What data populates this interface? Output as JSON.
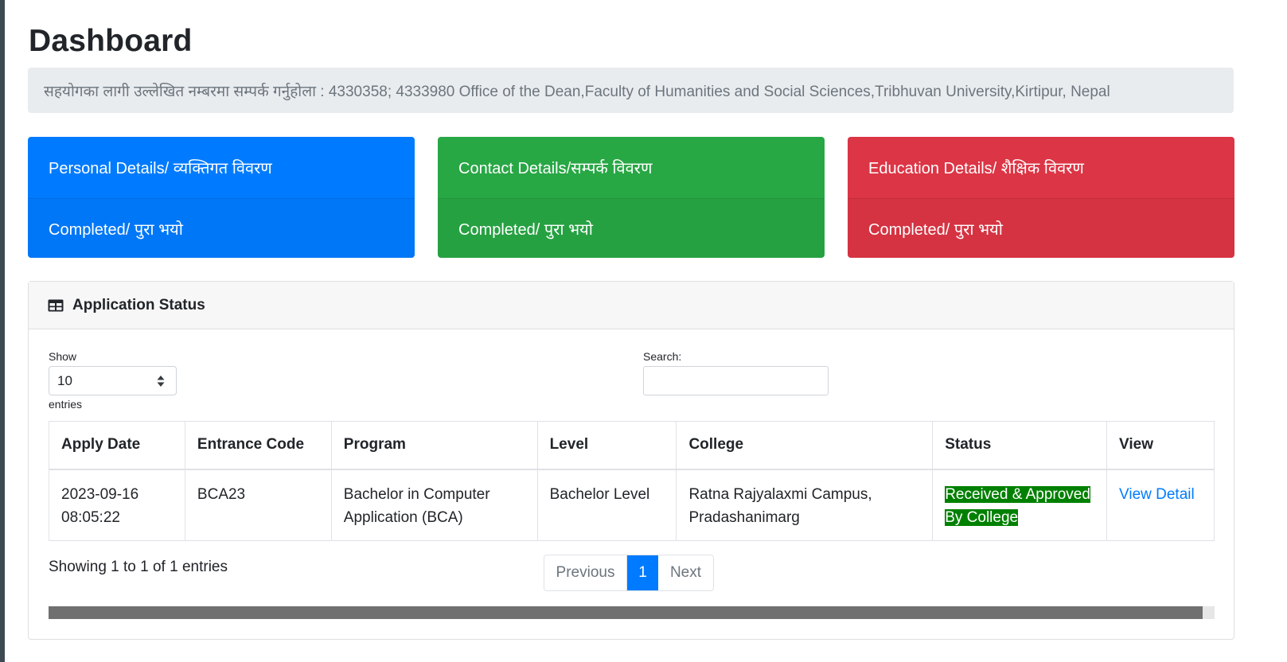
{
  "page": {
    "title": "Dashboard",
    "info_text": "सहयोगका लागी उल्लेखित नम्बरमा सम्पर्क गर्नुहोला : 4330358; 4333980 Office of the Dean,Faculty of Humanities and Social Sciences,Tribhuvan University,Kirtipur, Nepal"
  },
  "cards": [
    {
      "title": "Personal Details/ व्यक्तिगत विवरण",
      "status": "Completed/ पुरा भयो",
      "color": "#007bff"
    },
    {
      "title": "Contact Details/सम्पर्क विवरण",
      "status": "Completed/ पुरा भयो",
      "color": "#28a745"
    },
    {
      "title": "Education Details/ शैक्षिक विवरण",
      "status": "Completed/ पुरा भयो",
      "color": "#dc3545"
    }
  ],
  "application_status": {
    "header": "Application Status",
    "header_icon": "table-icon",
    "show_label": "Show",
    "entries_label": "entries",
    "page_size": "10",
    "search_label": "Search:",
    "search_value": "",
    "columns": [
      "Apply Date",
      "Entrance Code",
      "Program",
      "Level",
      "College",
      "Status",
      "View"
    ],
    "rows": [
      {
        "apply_date": "2023-09-16 08:05:22",
        "entrance_code": "BCA23",
        "program": "Bachelor in Computer Application (BCA)",
        "level": "Bachelor Level",
        "college": "Ratna Rajyalaxmi Campus, Pradashanimarg",
        "status": "Received & Approved By College",
        "status_color": "#008000",
        "view": "View Detail"
      }
    ],
    "showing_text": "Showing 1 to 1 of 1 entries",
    "pagination": {
      "previous": "Previous",
      "current": "1",
      "next": "Next"
    }
  },
  "colors": {
    "primary": "#007bff",
    "success": "#28a745",
    "danger": "#dc3545",
    "info_bg": "#e9ecef"
  }
}
